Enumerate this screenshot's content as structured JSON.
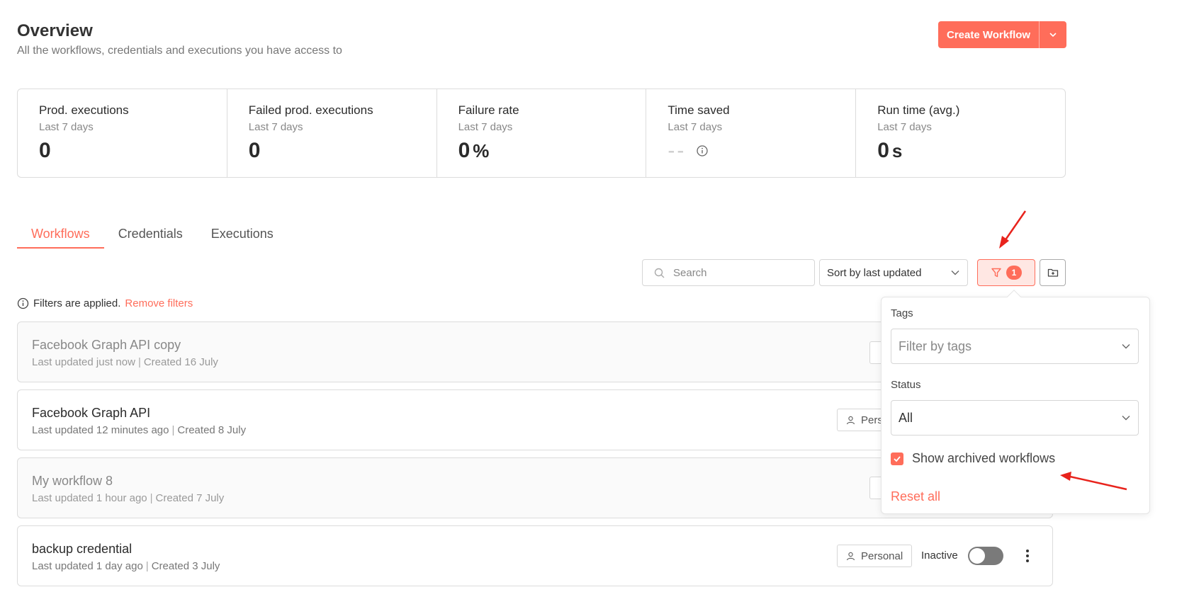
{
  "header": {
    "title": "Overview",
    "subtitle": "All the workflows, credentials and executions you have access to",
    "create_label": "Create Workflow"
  },
  "stats": [
    {
      "title": "Prod. executions",
      "sub": "Last 7 days",
      "value": "0",
      "unit": ""
    },
    {
      "title": "Failed prod. executions",
      "sub": "Last 7 days",
      "value": "0",
      "unit": ""
    },
    {
      "title": "Failure rate",
      "sub": "Last 7 days",
      "value": "0",
      "unit": "%"
    },
    {
      "title": "Time saved",
      "sub": "Last 7 days",
      "value": "--",
      "unit": ""
    },
    {
      "title": "Run time (avg.)",
      "sub": "Last 7 days",
      "value": "0",
      "unit": "s"
    }
  ],
  "tabs": [
    {
      "label": "Workflows",
      "active": true
    },
    {
      "label": "Credentials",
      "active": false
    },
    {
      "label": "Executions",
      "active": false
    }
  ],
  "toolbar": {
    "search_placeholder": "Search",
    "sort_label": "Sort by last updated",
    "filter_count": "1"
  },
  "notice": {
    "text": "Filters are applied.",
    "link": "Remove filters"
  },
  "workflows": [
    {
      "name": "Facebook Graph API copy",
      "updated": "Last updated just now",
      "created": "Created 16 July",
      "archived": true
    },
    {
      "name": "Facebook Graph API",
      "updated": "Last updated 12 minutes ago",
      "created": "Created 8 July",
      "archived": false,
      "owner": "Pers"
    },
    {
      "name": "My workflow 8",
      "updated": "Last updated 1 hour ago",
      "created": "Created 7 July",
      "archived": true
    },
    {
      "name": "backup credential",
      "updated": "Last updated 1 day ago",
      "created": "Created 3 July",
      "archived": false,
      "owner": "Personal",
      "status": "Inactive"
    }
  ],
  "filter_panel": {
    "tags_label": "Tags",
    "tags_placeholder": "Filter by tags",
    "status_label": "Status",
    "status_value": "All",
    "archived_label": "Show archived workflows",
    "archived_checked": true,
    "reset_label": "Reset all"
  },
  "colors": {
    "accent": "#ff6d5a",
    "annotation_arrow": "#e8231c"
  }
}
